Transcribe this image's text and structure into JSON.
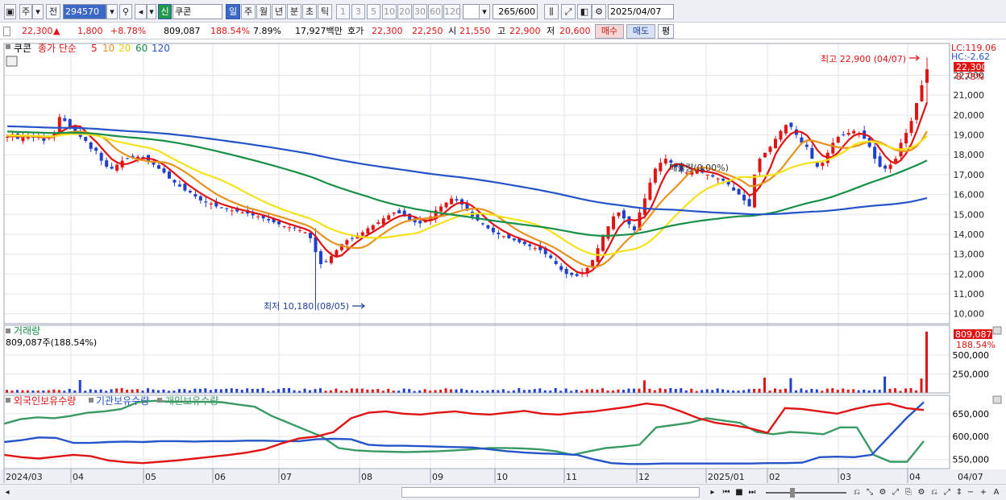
{
  "toolbar": {
    "period_main": "주",
    "prev_label": "전",
    "code": "294570",
    "new_label": "신",
    "name": "쿠콘",
    "period_day": "일",
    "period_week": "주",
    "period_month": "월",
    "period_year": "년",
    "period_minute": "분",
    "period_second": "초",
    "period_tick": "틱",
    "intervals": [
      "1",
      "3",
      "5",
      "10",
      "20",
      "30",
      "60",
      "120"
    ],
    "count": "265",
    "count_total": "/600",
    "date": "2025/04/07"
  },
  "quote": {
    "price": "22,300",
    "change_arrow": "▲",
    "change": "1,800",
    "change_pct": "+8.78%",
    "volume": "809,087",
    "volume_pct": "188.54%",
    "turnover": "7.89%",
    "amount": "17,927백만",
    "ask_label": "호가",
    "ask": "22,300",
    "bid": "22,250",
    "open_label": "시",
    "open": "21,550",
    "high_label": "고",
    "high": "22,900",
    "low_label": "저",
    "low": "20,600",
    "buy_label": "매수",
    "sell_label": "매도",
    "eval_label": "평"
  },
  "main_legend": {
    "name": "쿠콘",
    "type": "종가 단순",
    "ma": [
      "5",
      "10",
      "20",
      "60",
      "120"
    ],
    "ma_colors": [
      "#e01414",
      "#e8921e",
      "#f5e21a",
      "#189048",
      "#2454c8"
    ]
  },
  "right_labels": {
    "lc": "LC:119.06",
    "hc": "HC:-2.62",
    "price_box": "22,300",
    "pct": "8.78%",
    "vol_box": "809,087",
    "vol_pct": "188.54%"
  },
  "annotations": {
    "high": "최고 22,900 (04/07)",
    "low": "최저 10,180 (08/05)",
    "mid": "매물량(0.00%)"
  },
  "volume_panel": {
    "title": "거래량",
    "info": "809,087주(188.54%)"
  },
  "holdings_panel": {
    "foreign": "외국인보유수량",
    "inst": "기관보유수량",
    "indiv": "개인보유수량"
  },
  "scroll": {
    "tool": "A"
  },
  "chart_data": [
    {
      "type": "candlestick",
      "x": [
        "2024/03",
        "04",
        "05",
        "06",
        "07",
        "08",
        "09",
        "10",
        "11",
        "12",
        "2025/01",
        "02",
        "03",
        "04",
        "04/07"
      ],
      "ylim": [
        9500,
        23600
      ],
      "yticks": [
        10000,
        11000,
        12000,
        13000,
        14000,
        15000,
        16000,
        17000,
        18000,
        19000,
        20000,
        21000,
        22000
      ],
      "ytick_labels": [
        "10,000",
        "11,000",
        "12,000",
        "13,000",
        "14,000",
        "15,000",
        "16,000",
        "17,000",
        "18,000",
        "19,000",
        "20,000",
        "21,000",
        "22,000"
      ],
      "close": [
        18900,
        19050,
        18800,
        18900,
        19000,
        18850,
        18950,
        18700,
        18900,
        19100,
        19900,
        19700,
        19400,
        19200,
        18900,
        18700,
        18300,
        18200,
        17700,
        17400,
        17300,
        17500,
        17700,
        17800,
        17850,
        17900,
        17850,
        17700,
        17500,
        17300,
        17100,
        16800,
        16600,
        16400,
        16200,
        16100,
        15900,
        15700,
        15600,
        15550,
        15400,
        15350,
        15300,
        15200,
        15150,
        15100,
        15050,
        14950,
        14900,
        14800,
        14700,
        14600,
        14500,
        14400,
        14350,
        14300,
        14200,
        14100,
        13800,
        13100,
        12500,
        12600,
        12900,
        13200,
        13500,
        13700,
        13800,
        13950,
        14100,
        14300,
        14450,
        14600,
        14800,
        14950,
        15100,
        15050,
        14900,
        14700,
        14600,
        14550,
        14700,
        14900,
        15200,
        15400,
        15600,
        15800,
        15700,
        15500,
        15200,
        14900,
        14700,
        14500,
        14300,
        14100,
        14000,
        13900,
        13800,
        13700,
        13600,
        13500,
        13400,
        13300,
        13200,
        13000,
        12800,
        12500,
        12200,
        12000,
        11950,
        11900,
        12100,
        12300,
        12700,
        13300,
        13900,
        14400,
        14900,
        15100,
        14800,
        14500,
        14200,
        15100,
        15800,
        16600,
        17300,
        17600,
        17800,
        17600,
        17400,
        17200,
        17100,
        17200,
        17300,
        17100,
        17000,
        16900,
        16800,
        16700,
        16500,
        16200,
        16000,
        15700,
        15400,
        17000,
        17800,
        18100,
        18400,
        18800,
        19200,
        19500,
        19400,
        19000,
        18600,
        18400,
        17800,
        17400,
        17600,
        18100,
        18600,
        18900,
        19000,
        19100,
        19200,
        19100,
        18800,
        18400,
        17800,
        17400,
        17300,
        17500,
        17800,
        18600,
        19100,
        19700,
        20600,
        21500,
        22300
      ],
      "series": [
        {
          "name": "5",
          "color": "#e01414"
        },
        {
          "name": "10",
          "color": "#e8921e"
        },
        {
          "name": "20",
          "color": "#f5e21a"
        },
        {
          "name": "60",
          "color": "#189048"
        },
        {
          "name": "120",
          "color": "#2454c8"
        }
      ],
      "high_mark": 22900,
      "low_mark": 10180
    },
    {
      "type": "bar",
      "title": "거래량",
      "yticks": [
        250000,
        500000
      ],
      "ytick_labels": [
        "250,000",
        "500,000"
      ],
      "ylim": [
        0,
        850000
      ],
      "last": 809087
    },
    {
      "type": "line",
      "series": [
        {
          "name": "외국인보유수량",
          "color": "#e01414"
        },
        {
          "name": "기관보유수량",
          "color": "#2454c8"
        },
        {
          "name": "개인보유수량",
          "color": "#3a9a64"
        }
      ],
      "yticks": [
        550000,
        600000,
        650000
      ],
      "ytick_labels": [
        "550,000",
        "600,000",
        "650,000"
      ],
      "ylim": [
        530000,
        690000
      ],
      "foreign": [
        560000,
        555000,
        552000,
        556000,
        560000,
        557000,
        548000,
        544000,
        542000,
        545000,
        548000,
        552000,
        556000,
        560000,
        565000,
        572000,
        585000,
        596000,
        600000,
        610000,
        640000,
        652000,
        655000,
        650000,
        648000,
        652000,
        655000,
        650000,
        648000,
        652000,
        656000,
        650000,
        648000,
        652000,
        655000,
        660000,
        665000,
        672000,
        668000,
        655000,
        640000,
        630000,
        625000,
        618000,
        608000,
        662000,
        660000,
        655000,
        650000,
        660000,
        668000,
        672000,
        662000,
        658000
      ],
      "inst": [
        588000,
        592000,
        598000,
        597000,
        586000,
        586000,
        588000,
        589000,
        588000,
        590000,
        590000,
        589000,
        590000,
        590000,
        591000,
        591000,
        590000,
        590000,
        594000,
        595000,
        594000,
        582000,
        580000,
        580000,
        579000,
        578000,
        577000,
        576000,
        572000,
        568000,
        565000,
        563000,
        562000,
        560000,
        550000,
        542000,
        540000,
        540000,
        541000,
        541000,
        541000,
        541000,
        541000,
        541000,
        542000,
        542000,
        543000,
        555000,
        556000,
        555000,
        560000,
        600000,
        640000,
        675000
      ],
      "indiv": [
        628000,
        638000,
        642000,
        640000,
        645000,
        652000,
        655000,
        660000,
        675000,
        678000,
        676000,
        676000,
        676000,
        675000,
        670000,
        665000,
        645000,
        630000,
        615000,
        600000,
        575000,
        570000,
        568000,
        567000,
        566000,
        567000,
        568000,
        570000,
        572000,
        575000,
        575000,
        574000,
        572000,
        568000,
        560000,
        568000,
        575000,
        578000,
        582000,
        620000,
        625000,
        630000,
        640000,
        635000,
        630000,
        610000,
        605000,
        610000,
        608000,
        605000,
        620000,
        620000,
        560000,
        545000,
        545000,
        590000
      ]
    }
  ]
}
